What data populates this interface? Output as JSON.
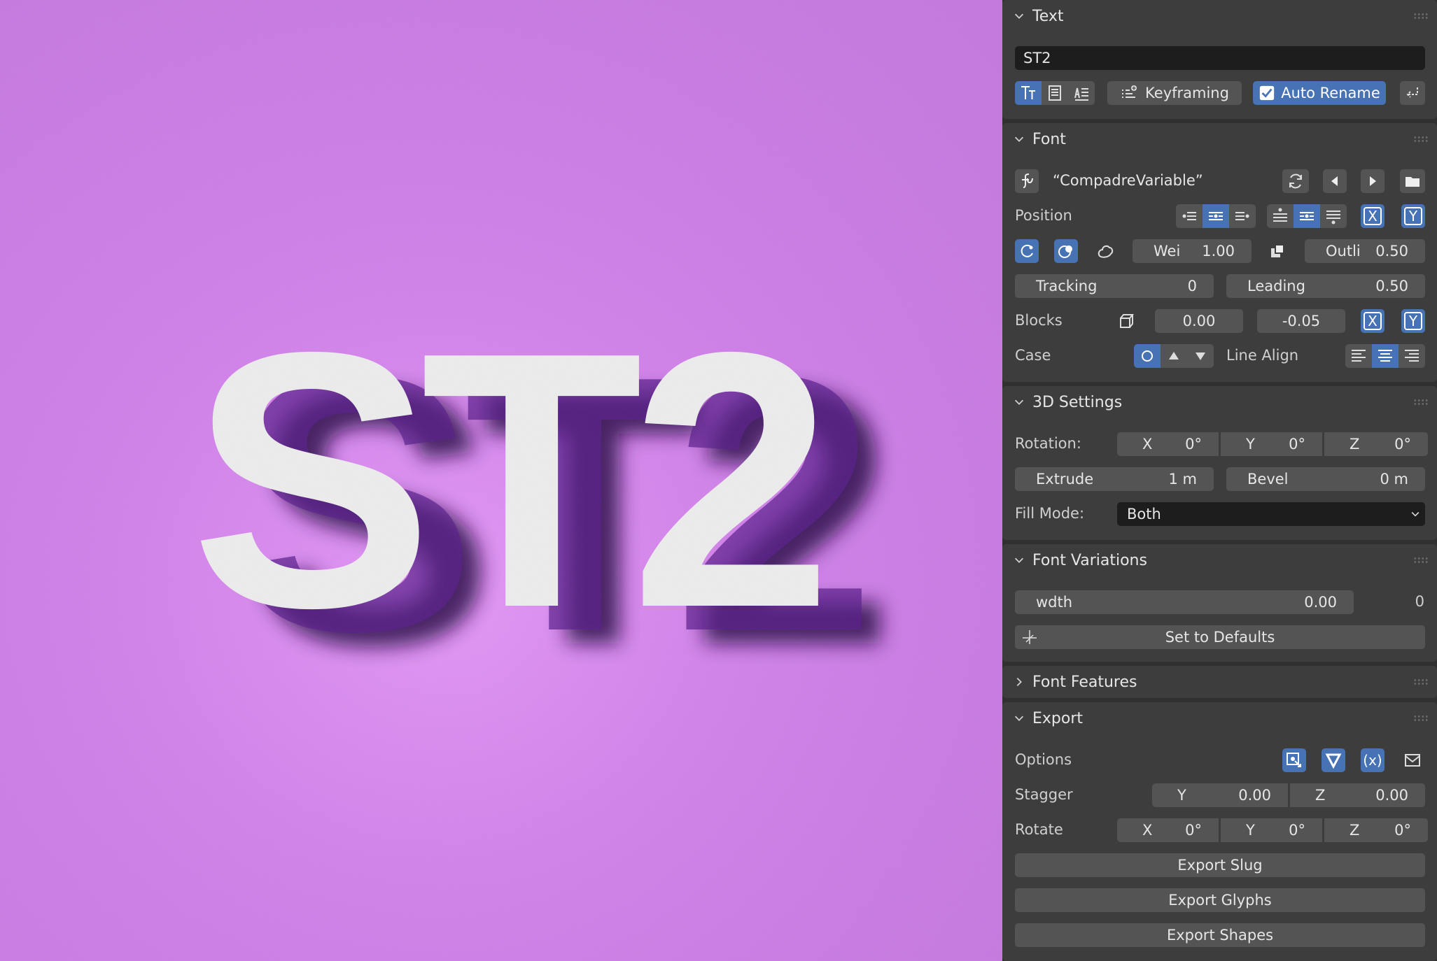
{
  "viewport": {
    "scene_text": "ST2",
    "background_color": "#cd7ee6",
    "letter_color": "#ececec",
    "shadow_color": "#2a0a4a"
  },
  "text_panel": {
    "title": "Text",
    "name_value": "ST2",
    "keyframing_label": "Keyframing",
    "auto_rename_label": "Auto Rename"
  },
  "font_panel": {
    "title": "Font",
    "font_name": "“CompadreVariable”",
    "position_label": "Position",
    "x_label": "X",
    "y_label": "Y",
    "weight": {
      "label": "Wei",
      "value": "1.00"
    },
    "outline": {
      "label": "Outli",
      "value": "0.50"
    },
    "tracking": {
      "label": "Tracking",
      "value": "0"
    },
    "leading": {
      "label": "Leading",
      "value": "0.50"
    },
    "blocks_label": "Blocks",
    "blocks_x": "0.00",
    "blocks_y": "-0.05",
    "case_label": "Case",
    "line_align_label": "Line Align"
  },
  "settings_3d": {
    "title": "3D Settings",
    "rotation_label": "Rotation:",
    "rotation": [
      {
        "axis": "X",
        "value": "0°"
      },
      {
        "axis": "Y",
        "value": "0°"
      },
      {
        "axis": "Z",
        "value": "0°"
      }
    ],
    "extrude": {
      "label": "Extrude",
      "value": "1 m"
    },
    "bevel": {
      "label": "Bevel",
      "value": "0 m"
    },
    "fill_mode_label": "Fill Mode:",
    "fill_mode_value": "Both"
  },
  "font_variations": {
    "title": "Font Variations",
    "wdth": {
      "label": "wdth",
      "value": "0.00",
      "default": "0"
    },
    "set_defaults_label": "Set to Defaults"
  },
  "font_features": {
    "title": "Font Features"
  },
  "export_panel": {
    "title": "Export",
    "options_label": "Options",
    "option_x_label": "(x)",
    "stagger_label": "Stagger",
    "stagger": [
      {
        "axis": "Y",
        "value": "0.00"
      },
      {
        "axis": "Z",
        "value": "0.00"
      }
    ],
    "rotate_label": "Rotate",
    "rotate": [
      {
        "axis": "X",
        "value": "0°"
      },
      {
        "axis": "Y",
        "value": "0°"
      },
      {
        "axis": "Z",
        "value": "0°"
      }
    ],
    "export_slug_label": "Export Slug",
    "export_glyphs_label": "Export Glyphs",
    "export_shapes_label": "Export Shapes"
  }
}
